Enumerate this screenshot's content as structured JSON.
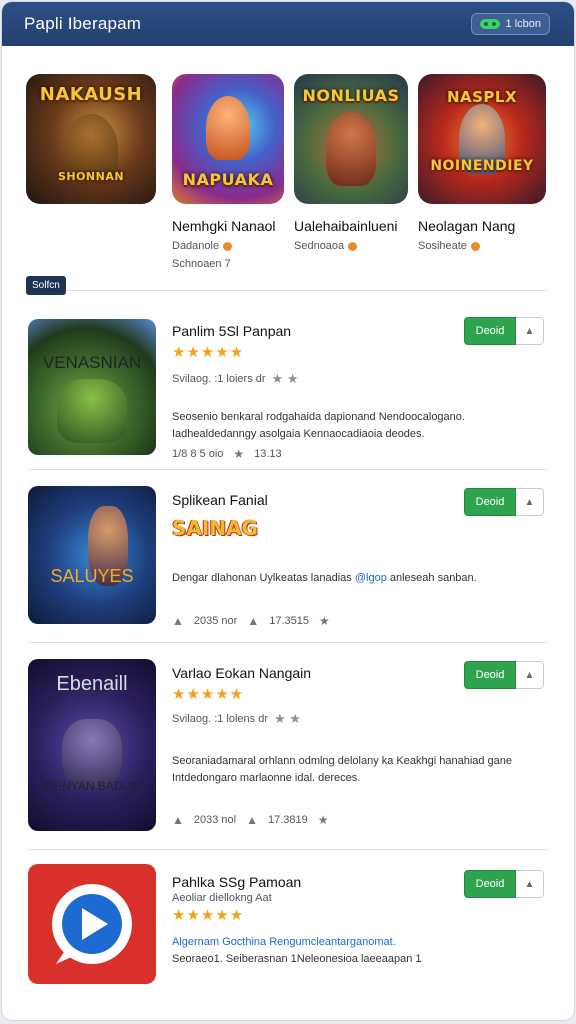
{
  "header": {
    "title": "Papli Iberapam",
    "pill_label": "1 lcbon"
  },
  "featured": [
    {
      "art": "NAKAUSH",
      "art2": "SHONNAN",
      "name": "Nemhgki Nanaol",
      "sub": "Dadanole",
      "sub2": "Schnoaen 7"
    },
    {
      "art": "",
      "art2": "NAPUAKA",
      "name": "Ualehaibainlueni",
      "sub": "Sednoaoa",
      "sub2": ""
    },
    {
      "art": "NONLIUAS",
      "art2": "",
      "name": "",
      "sub": "",
      "sub2": ""
    },
    {
      "art": "NASPLX",
      "art2": "NOINENDIEY",
      "name": "Neolagan Nang",
      "sub": "Sosiheate",
      "sub2": ""
    }
  ],
  "featured_badge": "Solfcn",
  "items": [
    {
      "art": "VENASNIAN",
      "name": "Panlim 5Sl Panpan",
      "stars": "★★★★★",
      "meta1": "Svilaog. :1 loiers dr",
      "desc": "Seosenio benkaral rodgahaida dapionand Nendoocalogano. Iadhealdedanngy asolgaia Kennaocadiaoia deodes.",
      "stat1": "1/8 8 5 oio",
      "stat2": "13.13",
      "get": "Deoid"
    },
    {
      "art": "SALUYES",
      "name": "Splikean Fanial",
      "logo": "SAINAG",
      "desc_a": "Dengar dlahonan Uylkeatas lanadias ",
      "desc_link": "@lgop",
      "desc_b": " anleseah sanban.",
      "stat1": "2035 nor",
      "stat2": "17.3515",
      "get": "Deoid"
    },
    {
      "art": "Ebenaill",
      "art2": "IDENYAN BADIAE",
      "name": "Varlao Eokan Nangain",
      "stars": "★★★★★",
      "meta1": "Svilaog. :1 lolens dr",
      "desc": "Seoraniadamaral orhlann odmlng delolany ka Keakhgi hanahiad gane Intdedongaro marlaonne idal. dereces.",
      "stat1": "2033 nol",
      "stat2": "17.3819",
      "get": "Deoid"
    },
    {
      "name": "Pahlka SSg Pamoan",
      "sub": "Aeoliar diellokng Aat",
      "stars": "★★★★★",
      "desc_a": "Algernam Gocthina Rengumcleantarganomat.",
      "desc_b": "Seoraeo1. Seiberasnan 1Neleonesioa laeeaapan 1",
      "get": "Deoid"
    }
  ],
  "colors": {
    "header_bg": "#23406f",
    "get_button": "#2ea44f",
    "star": "#f3a21a",
    "link": "#1d6bd0"
  }
}
